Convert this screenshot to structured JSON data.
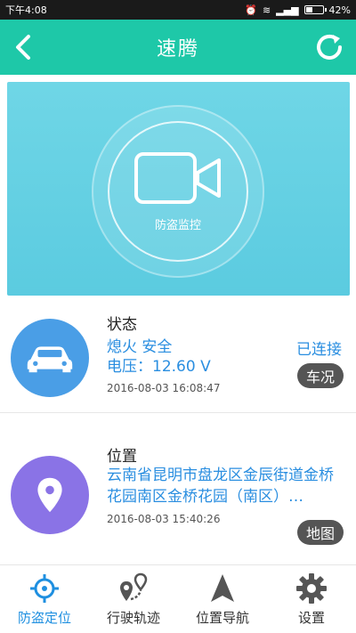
{
  "statusbar": {
    "time": "下午4:08",
    "battery": "42%",
    "battery_level": 0.42
  },
  "appbar": {
    "title": "速腾"
  },
  "hero": {
    "label": "防盗监控"
  },
  "status_card": {
    "heading": "状态",
    "line1": "熄火  安全",
    "line2": "电压：12.60 V",
    "connection": "已连接",
    "timestamp": "2016-08-03 16:08:47",
    "action": "车况"
  },
  "location_card": {
    "heading": "位置",
    "address": "云南省昆明市盘龙区金辰街道金桥花园南区金桥花园（南区）…",
    "timestamp": "2016-08-03 15:40:26",
    "action": "地图"
  },
  "nav": {
    "items": [
      {
        "label": "防盗定位",
        "icon": "crosshair-icon",
        "active": true
      },
      {
        "label": "行驶轨迹",
        "icon": "route-pin-icon",
        "active": false
      },
      {
        "label": "位置导航",
        "icon": "navigation-arrow-icon",
        "active": false
      },
      {
        "label": "设置",
        "icon": "gear-icon",
        "active": false
      }
    ]
  },
  "colors": {
    "primary": "#1ec8a8",
    "hero": "#5bcbe0",
    "accent_blue": "#2a8ee0",
    "status_avatar": "#4a9ee6",
    "location_avatar": "#8a73e6"
  }
}
